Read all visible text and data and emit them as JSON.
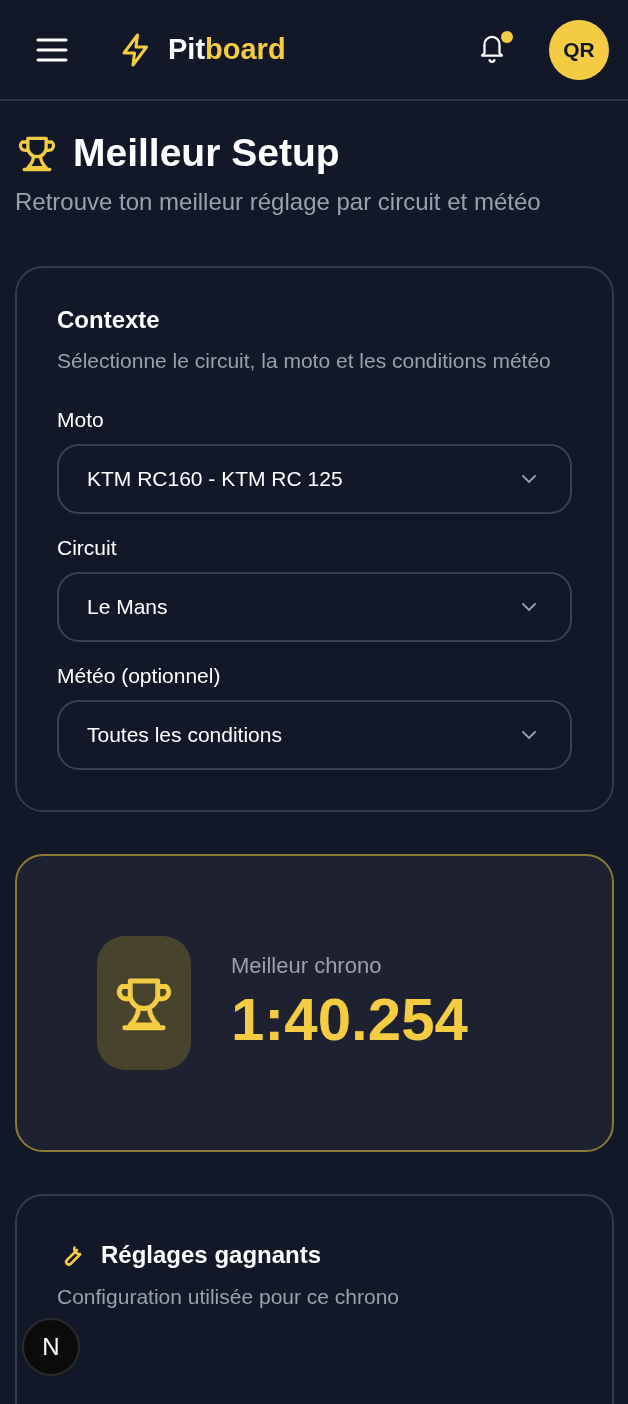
{
  "header": {
    "brand": [
      "Pit",
      "board"
    ],
    "notification_dot": true,
    "avatar": "QR"
  },
  "page": {
    "title": "Meilleur Setup",
    "subtitle": "Retrouve ton meilleur réglage par circuit et météo"
  },
  "context": {
    "title": "Contexte",
    "description": "Sélectionne le circuit, la moto et les conditions météo",
    "fields": [
      {
        "label": "Moto",
        "value": "KTM RC160 - KTM RC 125"
      },
      {
        "label": "Circuit",
        "value": "Le Mans"
      },
      {
        "label": "Météo (optionnel)",
        "value": "Toutes les conditions"
      }
    ]
  },
  "best_lap": {
    "label": "Meilleur chrono",
    "time": "1:40.254"
  },
  "settings": {
    "title": "Réglages gagnants",
    "description": "Configuration utilisée pour ce chrono"
  },
  "dev_badge": "N"
}
